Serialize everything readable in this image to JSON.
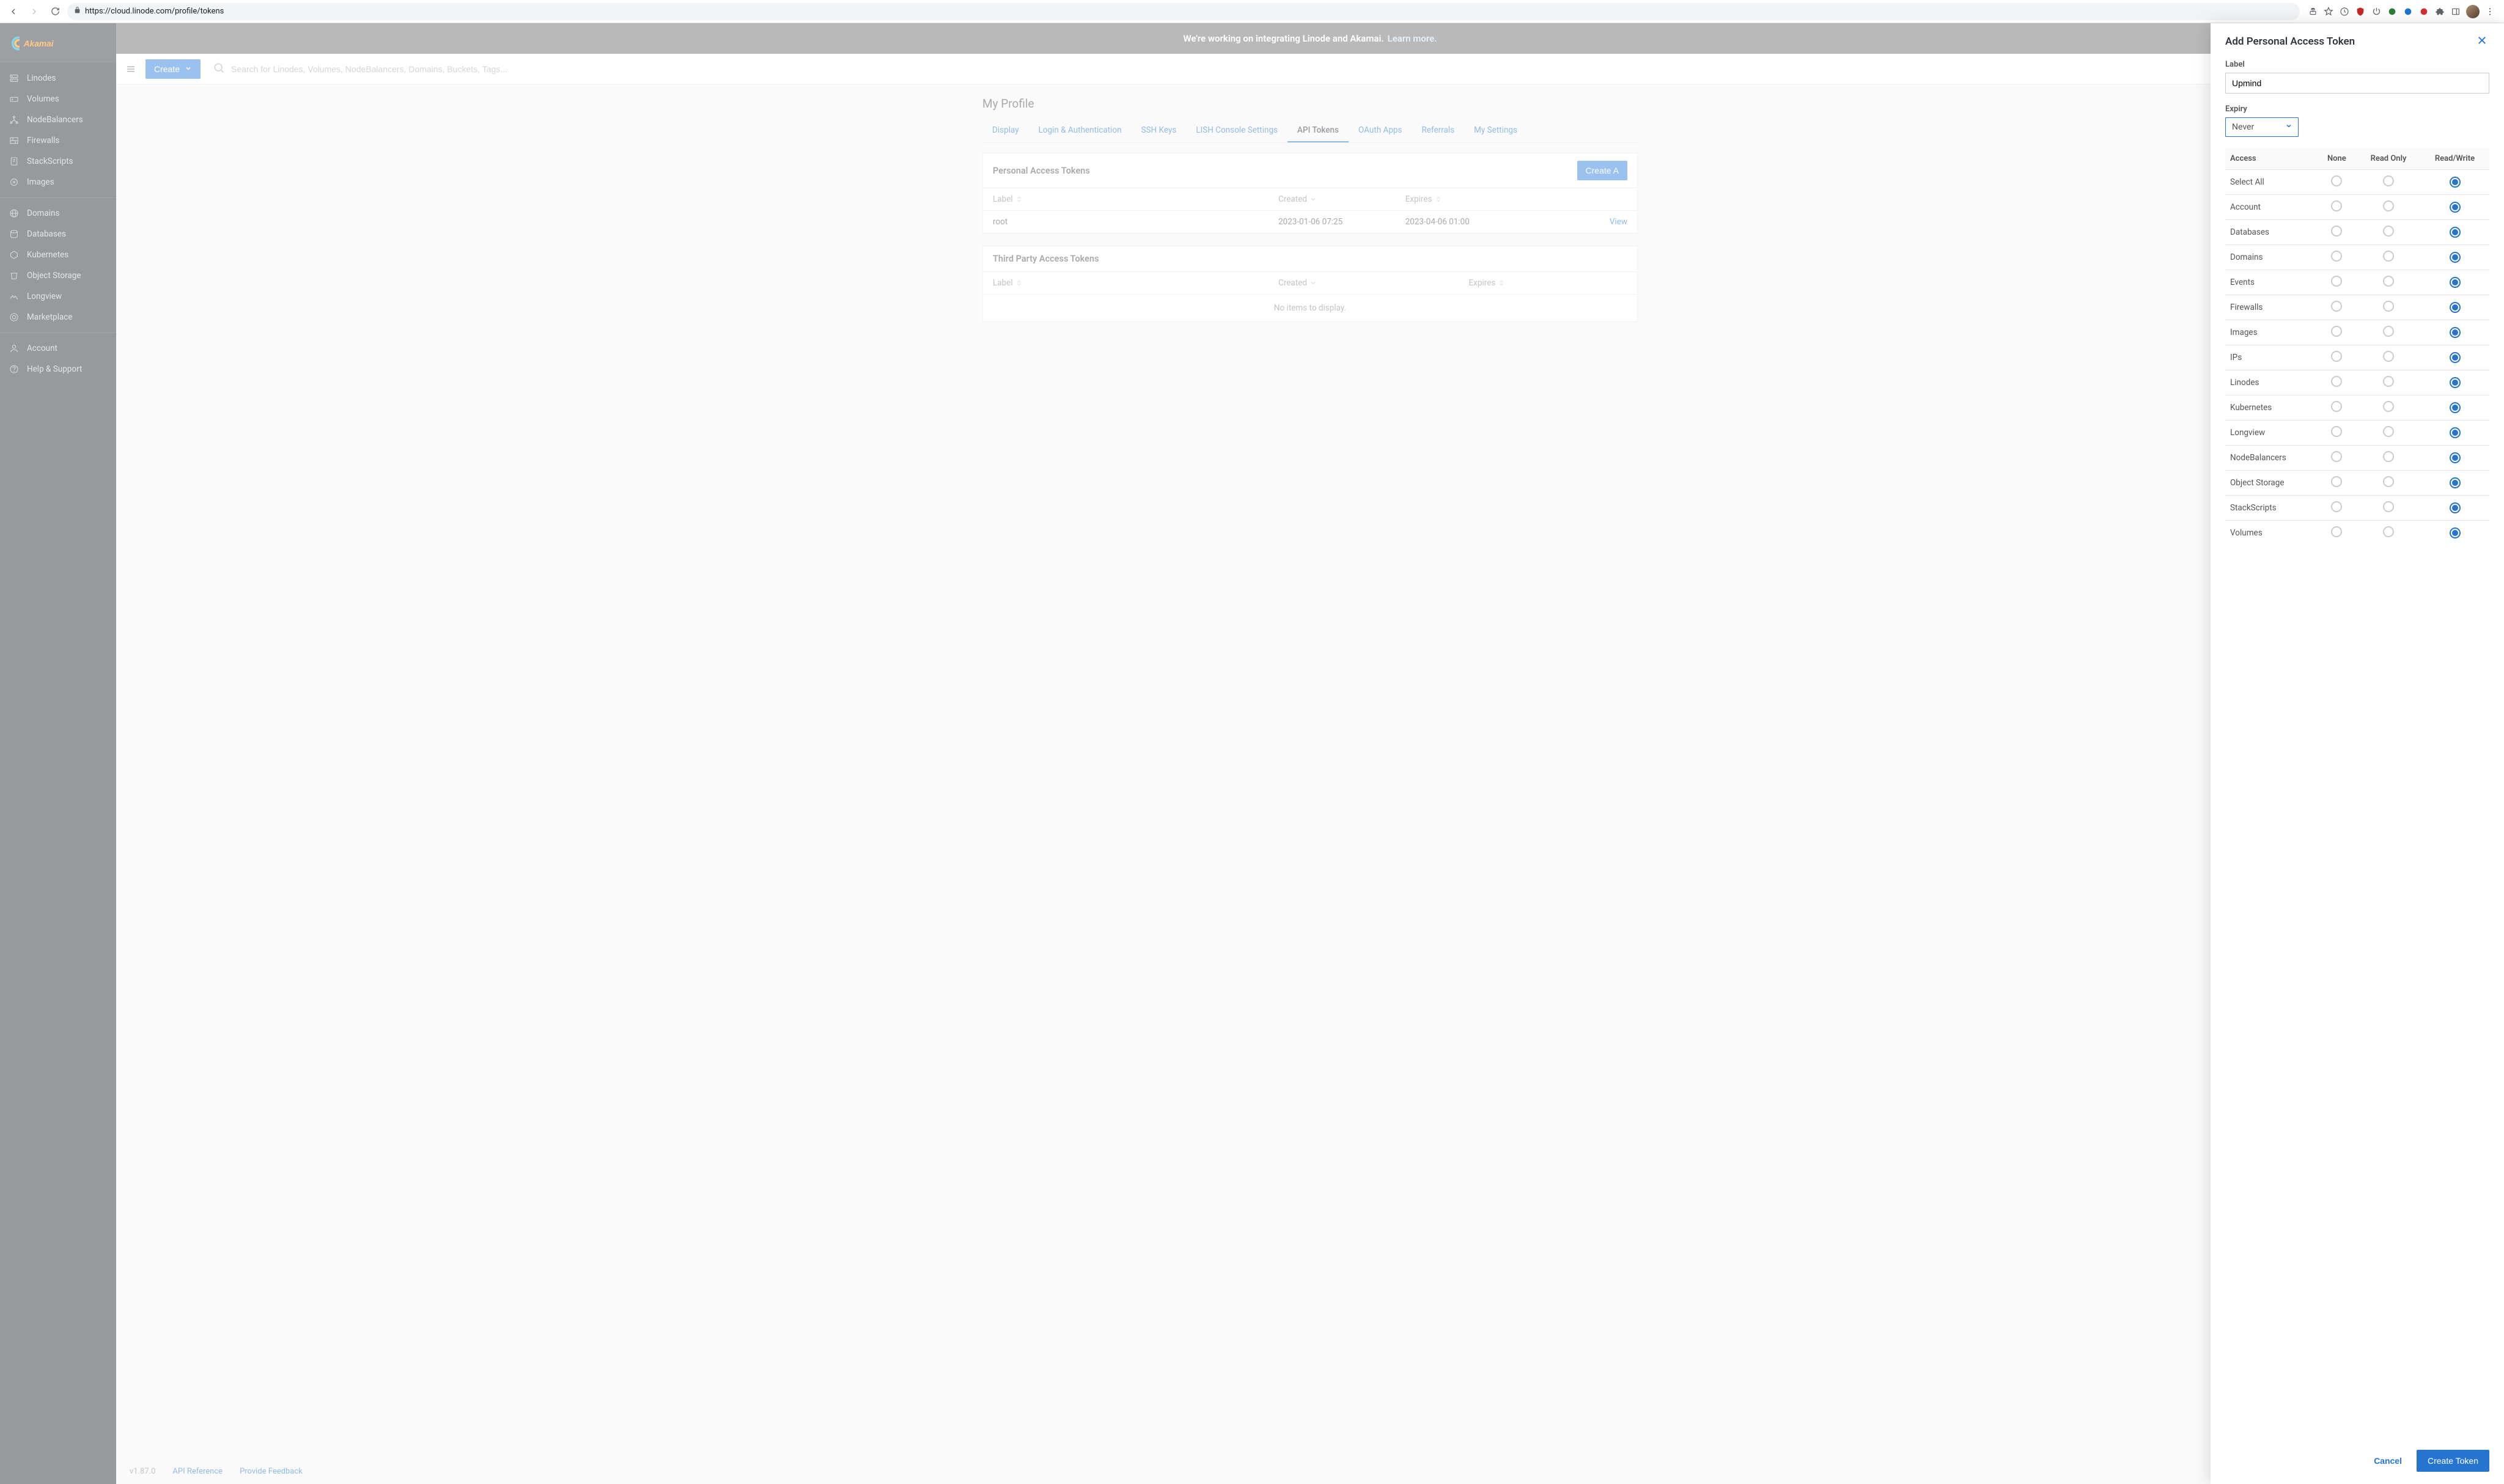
{
  "browser": {
    "url": "https://cloud.linode.com/profile/tokens"
  },
  "logo_text": "Akamai",
  "sidebar": {
    "group1": [
      {
        "icon": "server",
        "label": "Linodes"
      },
      {
        "icon": "hdd",
        "label": "Volumes"
      },
      {
        "icon": "nodebal",
        "label": "NodeBalancers"
      },
      {
        "icon": "firewall",
        "label": "Firewalls"
      },
      {
        "icon": "script",
        "label": "StackScripts"
      },
      {
        "icon": "image",
        "label": "Images"
      }
    ],
    "group2": [
      {
        "icon": "globe",
        "label": "Domains"
      },
      {
        "icon": "database",
        "label": "Databases"
      },
      {
        "icon": "kube",
        "label": "Kubernetes"
      },
      {
        "icon": "bucket",
        "label": "Object Storage"
      },
      {
        "icon": "longview",
        "label": "Longview"
      },
      {
        "icon": "market",
        "label": "Marketplace"
      }
    ],
    "group3": [
      {
        "icon": "user",
        "label": "Account"
      },
      {
        "icon": "help",
        "label": "Help & Support"
      }
    ]
  },
  "banner": {
    "text": "We're working on integrating Linode and Akamai.",
    "link": "Learn more."
  },
  "topbar": {
    "create": "Create",
    "search_placeholder": "Search for Linodes, Volumes, NodeBalancers, Domains, Buckets, Tags..."
  },
  "page": {
    "title": "My Profile",
    "tabs": [
      "Display",
      "Login & Authentication",
      "SSH Keys",
      "LISH Console Settings",
      "API Tokens",
      "OAuth Apps",
      "Referrals",
      "My Settings"
    ],
    "active_tab_index": 4
  },
  "pat_panel": {
    "title": "Personal Access Tokens",
    "create_btn": "Create A",
    "cols": {
      "label": "Label",
      "created": "Created",
      "expires": "Expires"
    },
    "rows": [
      {
        "label": "root",
        "created": "2023-01-06 07:25",
        "expires": "2023-04-06 01:00",
        "action": "View"
      }
    ]
  },
  "tp_panel": {
    "title": "Third Party Access Tokens",
    "cols": {
      "label": "Label",
      "created": "Created",
      "expires": "Expires"
    },
    "empty": "No items to display."
  },
  "footer": {
    "version": "v1.87.0",
    "api_ref": "API Reference",
    "feedback": "Provide Feedback"
  },
  "drawer": {
    "title": "Add Personal Access Token",
    "label_field_label": "Label",
    "label_value": "Upmind",
    "expiry_label": "Expiry",
    "expiry_value": "Never",
    "col_access": "Access",
    "col_none": "None",
    "col_ro": "Read Only",
    "col_rw": "Read/Write",
    "perms": [
      {
        "name": "Select All",
        "sel": "rw"
      },
      {
        "name": "Account",
        "sel": "rw"
      },
      {
        "name": "Databases",
        "sel": "rw"
      },
      {
        "name": "Domains",
        "sel": "rw"
      },
      {
        "name": "Events",
        "sel": "rw"
      },
      {
        "name": "Firewalls",
        "sel": "rw"
      },
      {
        "name": "Images",
        "sel": "rw"
      },
      {
        "name": "IPs",
        "sel": "rw"
      },
      {
        "name": "Linodes",
        "sel": "rw"
      },
      {
        "name": "Kubernetes",
        "sel": "rw"
      },
      {
        "name": "Longview",
        "sel": "rw"
      },
      {
        "name": "NodeBalancers",
        "sel": "rw"
      },
      {
        "name": "Object Storage",
        "sel": "rw"
      },
      {
        "name": "StackScripts",
        "sel": "rw"
      },
      {
        "name": "Volumes",
        "sel": "rw"
      }
    ],
    "cancel": "Cancel",
    "submit": "Create Token"
  }
}
